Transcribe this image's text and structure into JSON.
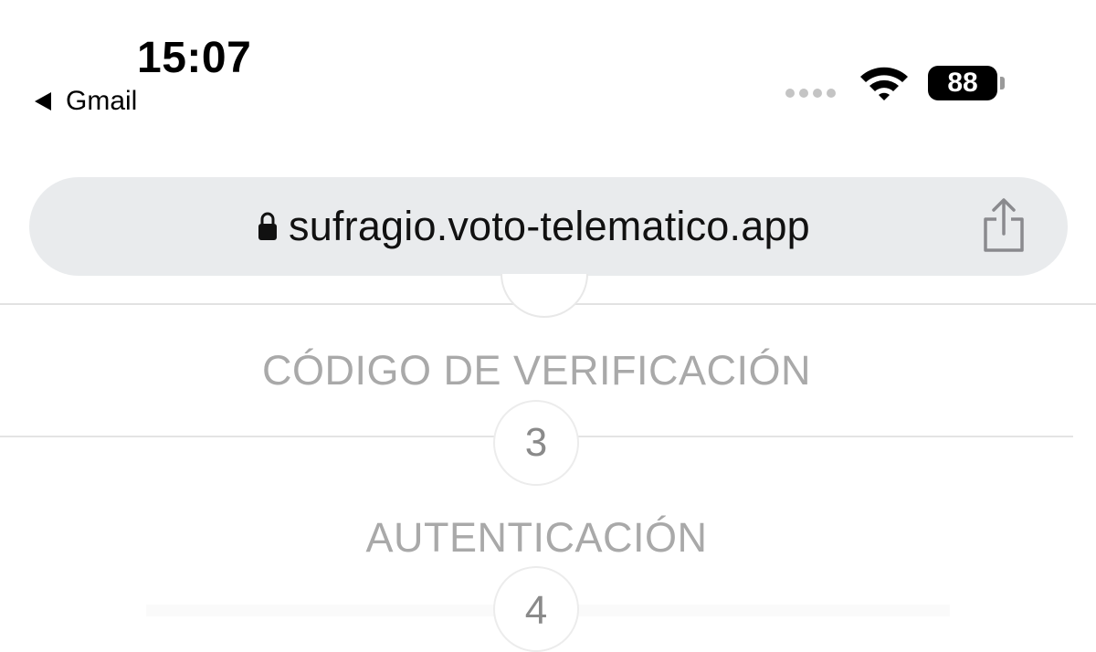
{
  "status_bar": {
    "time": "15:07",
    "back_app": "Gmail",
    "battery": "88"
  },
  "browser": {
    "url": "sufragio.voto-telematico.app",
    "lock_icon": "lock-icon",
    "share_icon": "share-icon"
  },
  "steps": [
    {
      "label": "CÓDIGO DE VERIFICACIÓN",
      "number": "3"
    },
    {
      "label": "AUTENTICACIÓN",
      "number": "4"
    }
  ],
  "colors": {
    "url_bar_bg": "#e9ebed",
    "step_text": "#a9a9a9",
    "step_number": "#8a8a8a"
  }
}
